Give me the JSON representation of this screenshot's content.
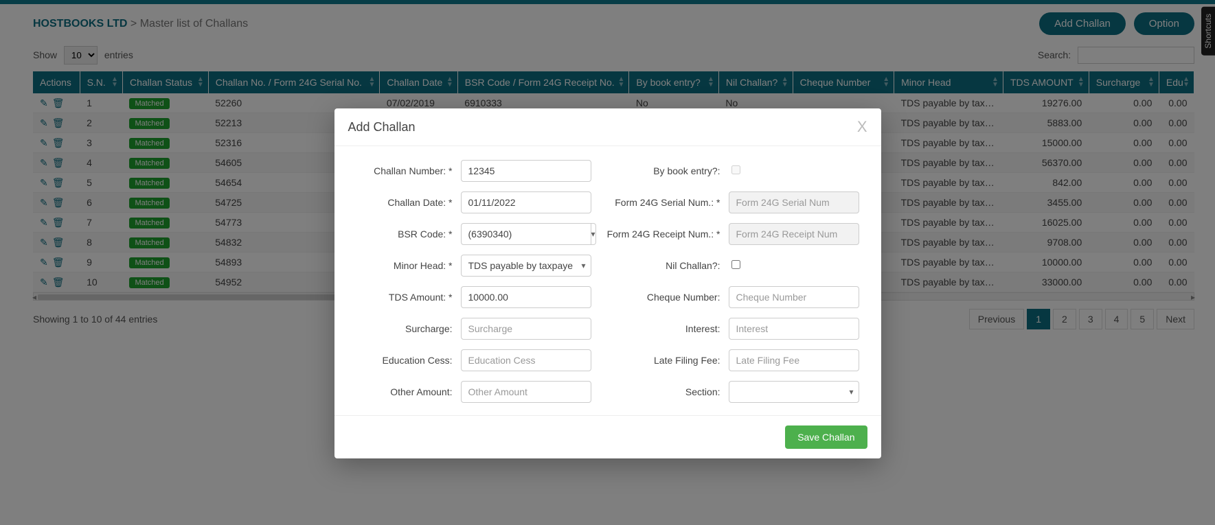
{
  "breadcrumb": {
    "company": "HOSTBOOKS LTD",
    "sep": " > ",
    "page": "Master list of Challans"
  },
  "buttons": {
    "add": "Add Challan",
    "option": "Option"
  },
  "show": {
    "prefix": "Show",
    "value": "10",
    "suffix": "entries"
  },
  "search_label": "Search:",
  "columns": [
    "Actions",
    "S.N.",
    "Challan Status",
    "Challan No. / Form 24G Serial No.",
    "Challan Date",
    "BSR Code / Form 24G Receipt No.",
    "By book entry?",
    "Nil Challan?",
    "Cheque Number",
    "Minor Head",
    "TDS AMOUNT",
    "Surcharge",
    "Edu"
  ],
  "status_label": "Matched",
  "rows": [
    {
      "sn": "1",
      "no": "52260",
      "date": "07/02/2019",
      "bsr": "6910333",
      "book": "No",
      "nil": "No",
      "cheque": "",
      "minor": "TDS payable by taxpayer",
      "tds": "19276.00",
      "sur": "0.00",
      "edu": "0.00"
    },
    {
      "sn": "2",
      "no": "52213",
      "date": "",
      "bsr": "",
      "book": "",
      "nil": "",
      "cheque": "",
      "minor": "TDS payable by taxpayer",
      "tds": "5883.00",
      "sur": "0.00",
      "edu": "0.00"
    },
    {
      "sn": "3",
      "no": "52316",
      "date": "",
      "bsr": "",
      "book": "",
      "nil": "",
      "cheque": "",
      "minor": "TDS payable by taxpayer",
      "tds": "15000.00",
      "sur": "0.00",
      "edu": "0.00"
    },
    {
      "sn": "4",
      "no": "54605",
      "date": "",
      "bsr": "",
      "book": "",
      "nil": "",
      "cheque": "",
      "minor": "TDS payable by taxpayer",
      "tds": "56370.00",
      "sur": "0.00",
      "edu": "0.00"
    },
    {
      "sn": "5",
      "no": "54654",
      "date": "",
      "bsr": "",
      "book": "",
      "nil": "",
      "cheque": "",
      "minor": "TDS payable by taxpayer",
      "tds": "842.00",
      "sur": "0.00",
      "edu": "0.00"
    },
    {
      "sn": "6",
      "no": "54725",
      "date": "",
      "bsr": "",
      "book": "",
      "nil": "",
      "cheque": "",
      "minor": "TDS payable by taxpayer",
      "tds": "3455.00",
      "sur": "0.00",
      "edu": "0.00"
    },
    {
      "sn": "7",
      "no": "54773",
      "date": "",
      "bsr": "",
      "book": "",
      "nil": "",
      "cheque": "",
      "minor": "TDS payable by taxpayer",
      "tds": "16025.00",
      "sur": "0.00",
      "edu": "0.00"
    },
    {
      "sn": "8",
      "no": "54832",
      "date": "",
      "bsr": "",
      "book": "",
      "nil": "",
      "cheque": "",
      "minor": "TDS payable by taxpayer",
      "tds": "9708.00",
      "sur": "0.00",
      "edu": "0.00"
    },
    {
      "sn": "9",
      "no": "54893",
      "date": "",
      "bsr": "",
      "book": "",
      "nil": "",
      "cheque": "",
      "minor": "TDS payable by taxpayer",
      "tds": "10000.00",
      "sur": "0.00",
      "edu": "0.00"
    },
    {
      "sn": "10",
      "no": "54952",
      "date": "",
      "bsr": "",
      "book": "",
      "nil": "",
      "cheque": "",
      "minor": "TDS payable by taxpayer",
      "tds": "33000.00",
      "sur": "0.00",
      "edu": "0.00"
    }
  ],
  "info": "Showing 1 to 10 of 44 entries",
  "pagination": {
    "prev": "Previous",
    "next": "Next",
    "pages": [
      "1",
      "2",
      "3",
      "4",
      "5"
    ],
    "active": "1"
  },
  "shortcuts": "Shortcuts",
  "modal": {
    "title": "Add Challan",
    "close": "X",
    "labels": {
      "challan_no": "Challan Number: *",
      "book": "By book entry?:",
      "date": "Challan Date: *",
      "serial": "Form 24G Serial Num.: *",
      "bsr": "BSR Code: *",
      "receipt": "Form 24G Receipt Num.: *",
      "minor": "Minor Head: *",
      "nil": "Nil Challan?:",
      "tds": "TDS Amount: *",
      "cheque": "Cheque Number:",
      "surcharge": "Surcharge:",
      "interest": "Interest:",
      "edu": "Education Cess:",
      "late": "Late Filing Fee:",
      "other": "Other Amount:",
      "section": "Section:"
    },
    "values": {
      "challan_no": "12345",
      "date": "01/11/2022",
      "bsr": "(6390340)",
      "minor": "TDS payable by taxpayer",
      "tds": "10000.00",
      "surcharge": "",
      "edu": "",
      "other": "",
      "serial": "",
      "receipt": "",
      "cheque": "",
      "interest": "",
      "late": "",
      "section": ""
    },
    "placeholders": {
      "serial": "Form 24G Serial Num",
      "receipt": "Form 24G Receipt Num",
      "cheque": "Cheque Number",
      "interest": "Interest",
      "late": "Late Filing Fee",
      "surcharge": "Surcharge",
      "edu": "Education Cess",
      "other": "Other Amount"
    },
    "save": "Save Challan"
  }
}
